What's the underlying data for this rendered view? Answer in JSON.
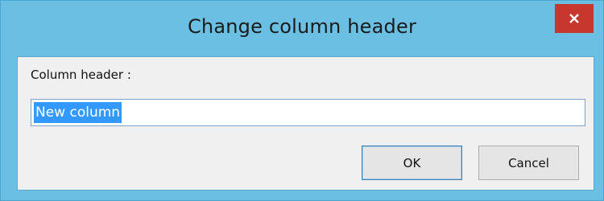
{
  "window": {
    "title": "Change column header",
    "close_icon": "close-icon"
  },
  "form": {
    "label": "Column header :",
    "input_value": "New column"
  },
  "buttons": {
    "ok_label": "OK",
    "cancel_label": "Cancel"
  },
  "colors": {
    "frame": "#6bbfe3",
    "close_button": "#c7372e",
    "selection": "#3399ff"
  }
}
